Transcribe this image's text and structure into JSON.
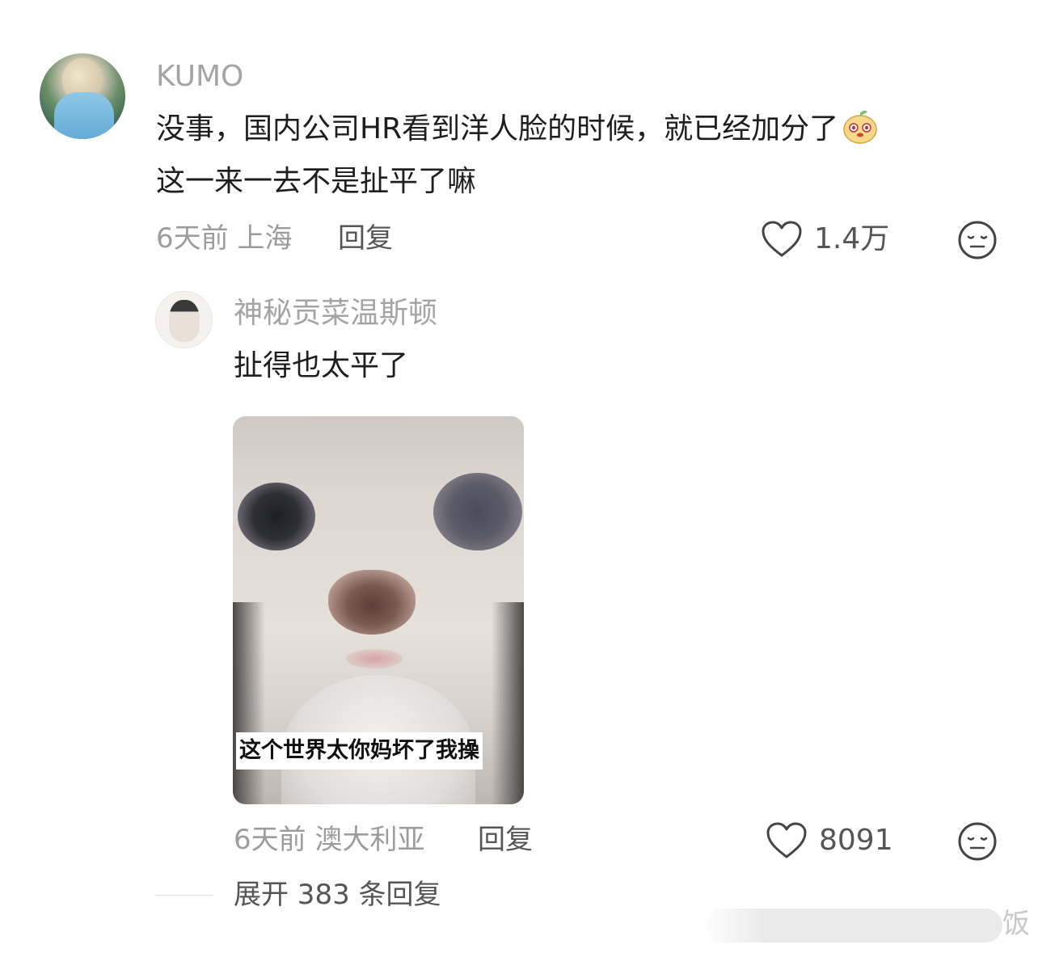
{
  "comment": {
    "username": "KUMO",
    "line1": "没事，国内公司HR看到洋人脸的时候，就已经加分了",
    "line2": "这一来一去不是扯平了嘛",
    "time_location": "6天前 上海",
    "reply_label": "回复",
    "like_count": "1.4万"
  },
  "reply": {
    "username": "神秘贡菜温斯顿",
    "text": "扯得也太平了",
    "image_caption": "这个世界太你妈坏了我操",
    "time_location": "6天前 澳大利亚",
    "reply_label": "回复",
    "like_count": "8091"
  },
  "expand_label": "展开 383 条回复",
  "watermark_text": "饭",
  "colors": {
    "username": "#a4a4a4",
    "text": "#1e1e1e",
    "meta": "#9c9c9c",
    "action": "#555555"
  }
}
